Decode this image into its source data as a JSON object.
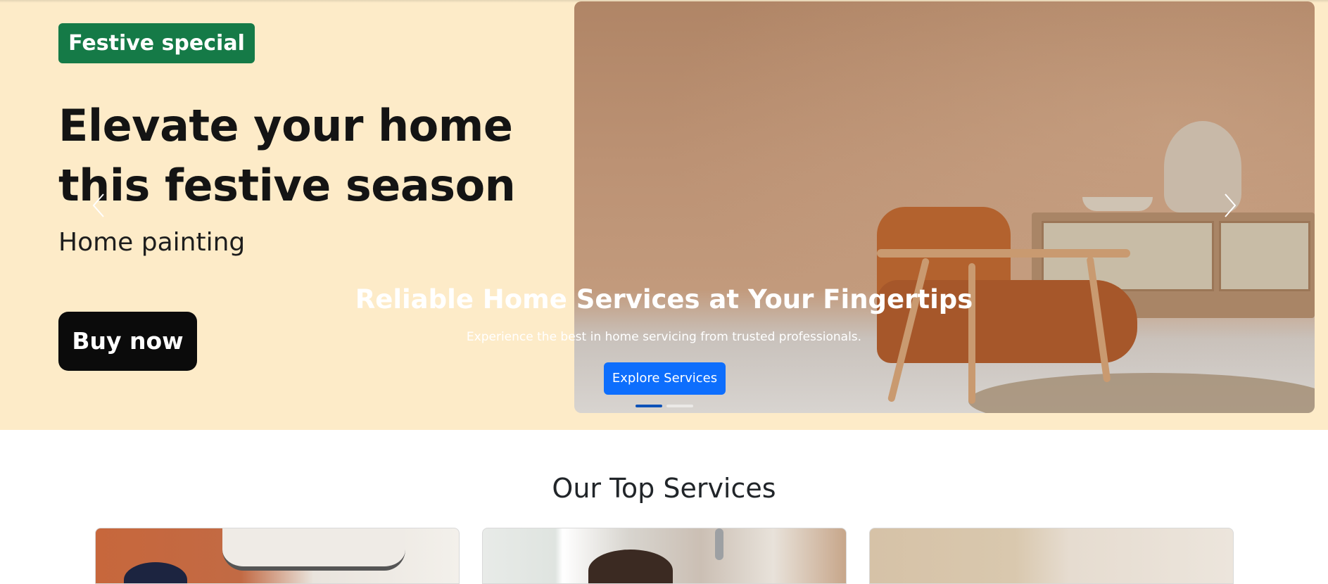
{
  "hero": {
    "badge": "Festive special",
    "headline_line1": "Elevate your home",
    "headline_line2": "this festive season",
    "subhead": "Home painting",
    "buy_button": "Buy now",
    "overlay_title": "Reliable Home Services at Your Fingertips",
    "overlay_subtitle": "Experience the best in home servicing from trusted professionals.",
    "cta_button": "Explore Services",
    "slide_count": 2,
    "active_slide": 1,
    "prev_icon": "chevron-left-icon",
    "next_icon": "chevron-right-icon"
  },
  "services": {
    "title": "Our Top Services",
    "cards": [
      {
        "image": "ac-technician"
      },
      {
        "image": "kitchen-cleaning"
      },
      {
        "image": "interior-room"
      }
    ]
  },
  "colors": {
    "hero_background": "#fdebc8",
    "badge": "#157a47",
    "buy_button": "#0b0b0b",
    "primary": "#0d6efd"
  }
}
